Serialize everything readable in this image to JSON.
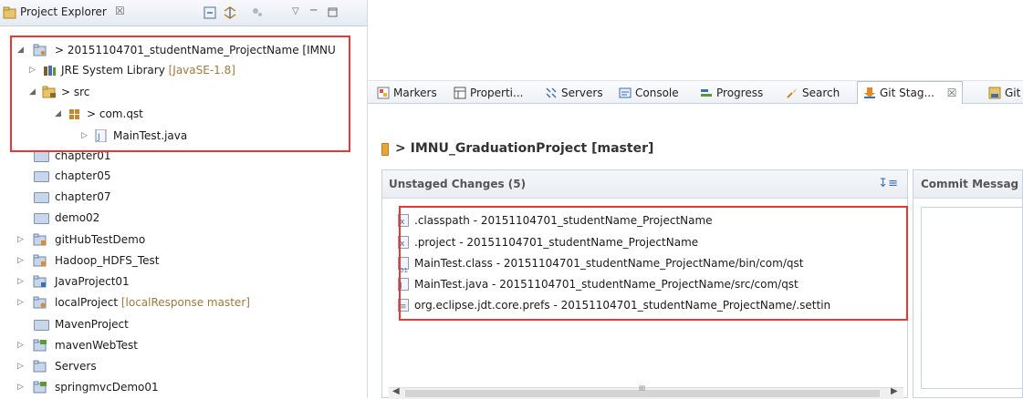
{
  "explorer": {
    "title": "Project Explorer",
    "close_glyph": "☒",
    "tree": [
      {
        "id": "proj",
        "label": "> 20151104701_studentName_ProjectName [IMNU",
        "decoration": "",
        "twisty": "◢",
        "icon": "git-project-icon"
      },
      {
        "id": "jre",
        "label": "JRE System Library",
        "decoration": " [JavaSE-1.8]",
        "twisty": "▷",
        "icon": "library-icon"
      },
      {
        "id": "src",
        "label": "> src",
        "decoration": "",
        "twisty": "◢",
        "icon": "source-folder-icon"
      },
      {
        "id": "pkg",
        "label": "> com.qst",
        "decoration": "",
        "twisty": "◢",
        "icon": "package-icon"
      },
      {
        "id": "main",
        "label": "MainTest.java",
        "decoration": "",
        "twisty": "▷",
        "icon": "java-file-icon"
      },
      {
        "id": "ch01",
        "label": "chapter01",
        "decoration": "",
        "twisty": "",
        "icon": "folder-icon"
      },
      {
        "id": "ch05",
        "label": "chapter05",
        "decoration": "",
        "twisty": "",
        "icon": "folder-icon"
      },
      {
        "id": "ch07",
        "label": "chapter07",
        "decoration": "",
        "twisty": "",
        "icon": "folder-icon"
      },
      {
        "id": "demo02",
        "label": "demo02",
        "decoration": "",
        "twisty": "",
        "icon": "folder-icon"
      },
      {
        "id": "gh",
        "label": "gitHubTestDemo",
        "decoration": "",
        "twisty": "▷",
        "icon": "project-icon"
      },
      {
        "id": "hdfs",
        "label": "Hadoop_HDFS_Test",
        "decoration": "",
        "twisty": "▷",
        "icon": "project-icon"
      },
      {
        "id": "jp01",
        "label": "JavaProject01",
        "decoration": "",
        "twisty": "▷",
        "icon": "project-icon"
      },
      {
        "id": "local",
        "label": "localProject",
        "decoration": " [localResponse master]",
        "twisty": "▷",
        "icon": "git-project-icon"
      },
      {
        "id": "maven",
        "label": "MavenProject",
        "decoration": "",
        "twisty": "",
        "icon": "folder-icon"
      },
      {
        "id": "mweb",
        "label": "mavenWebTest",
        "decoration": "",
        "twisty": "▷",
        "icon": "web-project-icon"
      },
      {
        "id": "servers",
        "label": "Servers",
        "decoration": "",
        "twisty": "▷",
        "icon": "project-icon"
      },
      {
        "id": "spring",
        "label": "springmvcDemo01",
        "decoration": "",
        "twisty": "▷",
        "icon": "web-project-icon"
      }
    ]
  },
  "tabs": [
    {
      "label": "Markers",
      "icon": "markers-icon"
    },
    {
      "label": "Properti...",
      "icon": "properties-icon"
    },
    {
      "label": "Servers",
      "icon": "servers-icon"
    },
    {
      "label": "Console",
      "icon": "console-icon"
    },
    {
      "label": "Progress",
      "icon": "progress-icon"
    },
    {
      "label": "Search",
      "icon": "search-icon"
    },
    {
      "label": "Git Stag...",
      "icon": "git-staging-icon",
      "close": "☒"
    },
    {
      "label": "Git",
      "icon": "git-repo-icon"
    }
  ],
  "staging": {
    "repo_title": "> IMNU_GraduationProject [master]",
    "unstaged_title": "Unstaged Changes (5)",
    "commit_title": "Commit Messag",
    "files": [
      {
        "label": ".classpath - 20151104701_studentName_ProjectName",
        "icon": "xml-file-icon",
        "glyph": "x"
      },
      {
        "label": ".project - 20151104701_studentName_ProjectName",
        "icon": "xml-file-icon",
        "glyph": "x"
      },
      {
        "label": "MainTest.class - 20151104701_studentName_ProjectName/bin/com/qst",
        "icon": "class-file-icon",
        "glyph": "01"
      },
      {
        "label": "MainTest.java - 20151104701_studentName_ProjectName/src/com/qst",
        "icon": "java-file-icon",
        "glyph": "J"
      },
      {
        "label": "org.eclipse.jdt.core.prefs - 20151104701_studentName_ProjectName/.settin",
        "icon": "text-file-icon",
        "glyph": "≡"
      }
    ],
    "scroll_left": "◀",
    "scroll_right": "▶",
    "scroll_grip": "III"
  },
  "colors": {
    "highlight_border": "#e53935",
    "decoration": "#9c7a3c",
    "accent": "#3b6fb6"
  }
}
